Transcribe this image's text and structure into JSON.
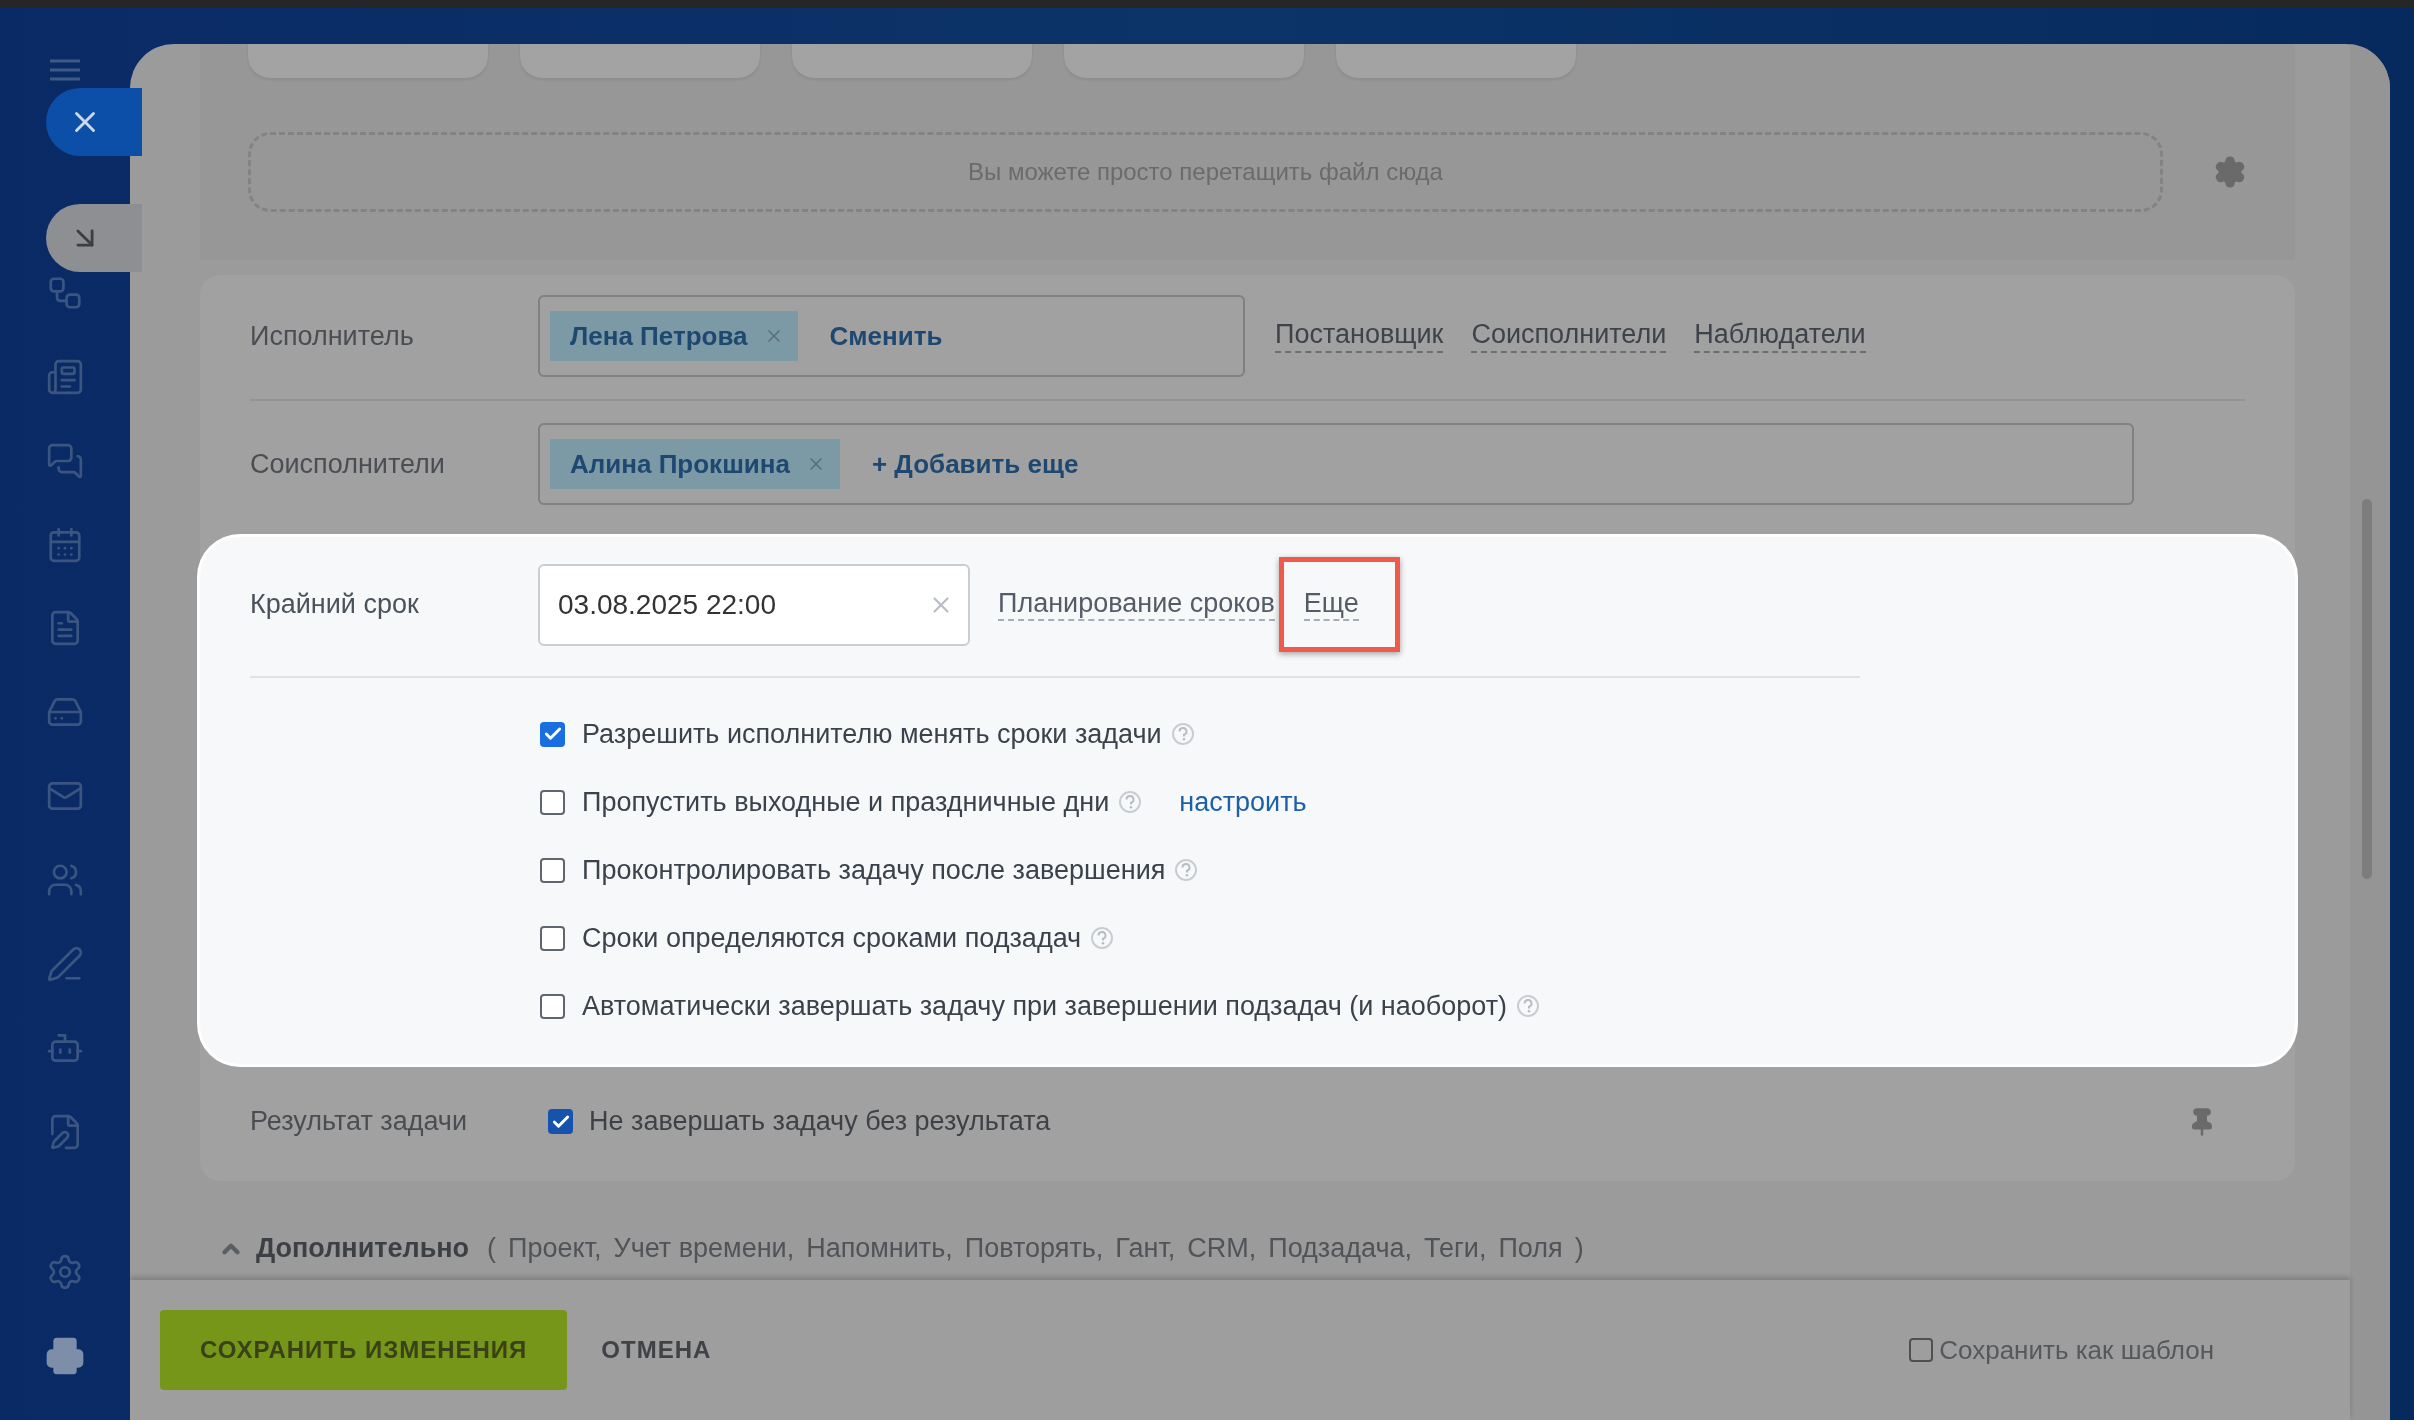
{
  "dropzone": {
    "text": "Вы можете просто перетащить файл сюда"
  },
  "responsible": {
    "label": "Исполнитель",
    "tags": [
      {
        "name": "Лена Петрова"
      }
    ],
    "action": "Сменить",
    "links": [
      "Постановщик",
      "Соисполнители",
      "Наблюдатели"
    ]
  },
  "accomplices": {
    "label": "Соисполнители",
    "tags": [
      {
        "name": "Алина Прокшина"
      }
    ],
    "action": "+ Добавить еще"
  },
  "deadline": {
    "label": "Крайний срок",
    "value": "03.08.2025 22:00",
    "links": [
      {
        "text": "Планирование сроков",
        "highlighted": false
      },
      {
        "text": "Еще",
        "highlighted": true
      }
    ],
    "options": [
      {
        "label": "Разрешить исполнителю менять сроки задачи",
        "checked": true
      },
      {
        "label": "Пропустить выходные и праздничные дни",
        "checked": false,
        "link": "настроить"
      },
      {
        "label": "Проконтролировать задачу после завершения",
        "checked": false
      },
      {
        "label": "Сроки определяются сроками подзадач",
        "checked": false
      },
      {
        "label": "Автоматически завершать задачу при завершении подзадач (и наоборот)",
        "checked": false
      }
    ]
  },
  "result": {
    "label": "Результат задачи",
    "checkbox": {
      "label": "Не завершать задачу без результата",
      "checked": true
    }
  },
  "more": {
    "title": "Дополнительно",
    "expanded": true,
    "open": "(",
    "close": ")",
    "items": [
      "Проект,",
      "Учет времени,",
      "Напомнить,",
      "Повторять,",
      "Гант,",
      "CRM,",
      "Подзадача,",
      "Теги,",
      "Поля"
    ]
  },
  "footer": {
    "save": "СОХРАНИТЬ ИЗМЕНЕНИЯ",
    "cancel": "ОТМЕНА",
    "template": {
      "label": "Сохранить как шаблон",
      "checked": false
    }
  }
}
